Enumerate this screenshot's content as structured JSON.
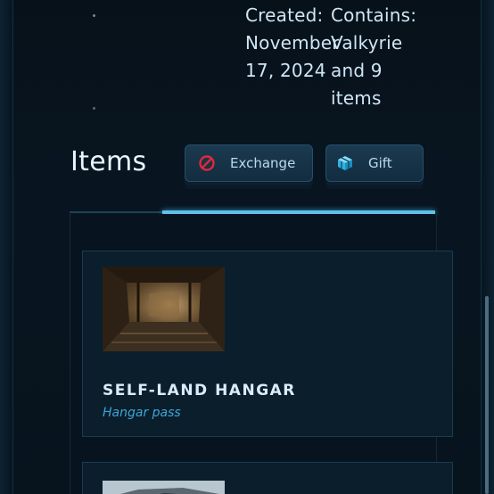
{
  "meta": {
    "created_text": "Created:\nNovember\n17, 2024",
    "contains_text": "Contains:\nValkyrie\nand 9\nitems"
  },
  "items_section": {
    "title": "Items",
    "buttons": {
      "exchange_label": "Exchange",
      "gift_label": "Gift"
    }
  },
  "items": [
    {
      "name": "SELF-LAND HANGAR",
      "subtitle": "Hangar pass",
      "thumbnail": "hangar-interior-image"
    },
    {
      "name": "",
      "subtitle": "",
      "thumbnail": "ship-image"
    }
  ],
  "icons": {
    "exchange": "prohibited-circle-icon",
    "gift": "gift-box-icon"
  },
  "colors": {
    "accent": "#63c0e6",
    "subtitle": "#3ea6d6",
    "exchange_icon": "#e0283a",
    "gift_icon": "#49c8f0"
  }
}
